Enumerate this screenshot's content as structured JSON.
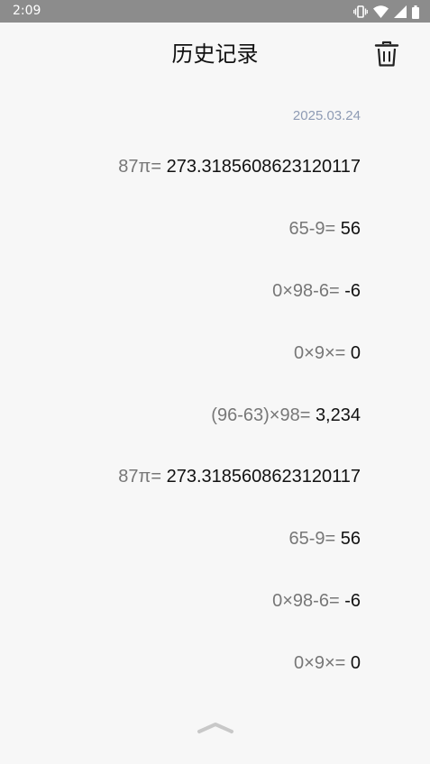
{
  "status_bar": {
    "time": "2:09",
    "icons": [
      "vibrate-icon",
      "wifi-icon",
      "cell-signal-icon",
      "battery-icon"
    ]
  },
  "header": {
    "title": "历史记录",
    "delete_icon": "trash-icon"
  },
  "history": {
    "date": "2025.03.24",
    "entries": [
      {
        "expression": "87π=",
        "result": "273.3185608623120117"
      },
      {
        "expression": "65-9=",
        "result": "56"
      },
      {
        "expression": "0×98-6=",
        "result": "-6"
      },
      {
        "expression": "0×9×=",
        "result": "0"
      },
      {
        "expression": "(96-63)×98=",
        "result": "3,234"
      },
      {
        "expression": "87π=",
        "result": "273.3185608623120117"
      },
      {
        "expression": "65-9=",
        "result": "56"
      },
      {
        "expression": "0×98-6=",
        "result": "-6"
      },
      {
        "expression": "0×9×=",
        "result": "0"
      }
    ]
  },
  "footer": {
    "collapse_icon": "chevron-up-icon"
  },
  "colors": {
    "background": "#f7f7f7",
    "status_bar": "#8c8c8c",
    "expression_text": "#777777",
    "result_text": "#111111",
    "date_text": "#8e9bb4",
    "chevron": "#c8c8c8"
  }
}
